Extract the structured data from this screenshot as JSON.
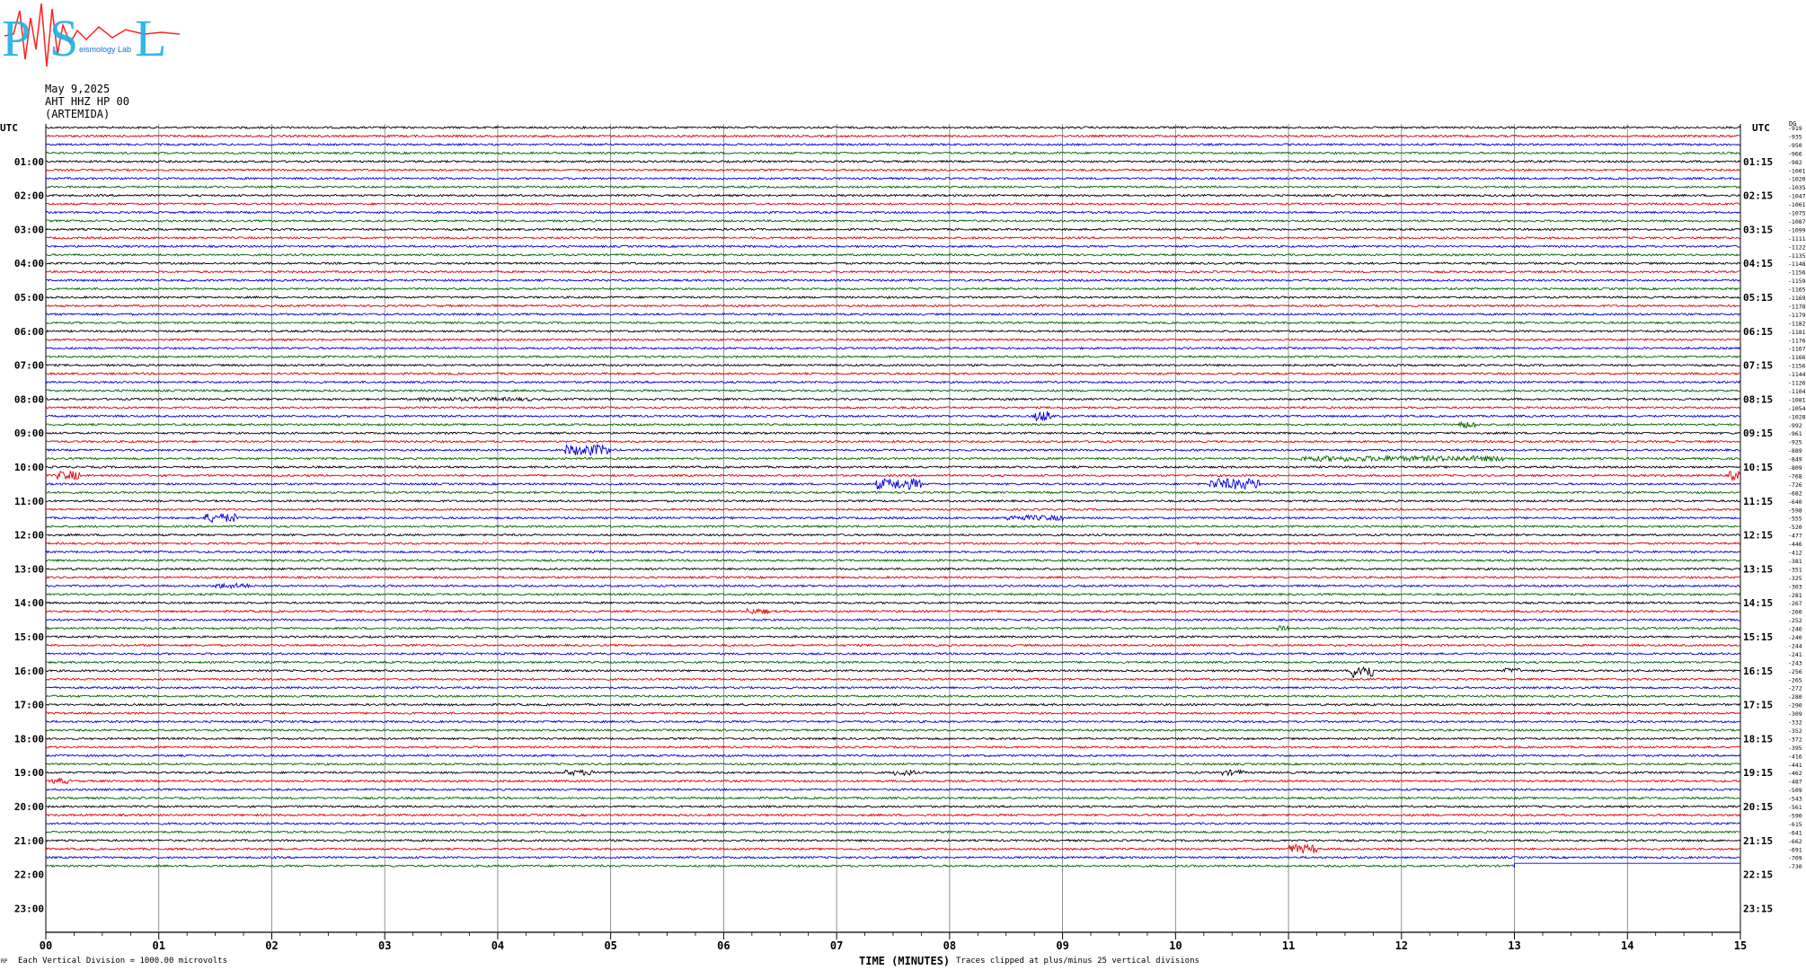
{
  "logo": {
    "letters": [
      "P",
      "S",
      "L"
    ],
    "caption": "eismology Lab",
    "colors": {
      "letters": "#1fb0e6",
      "wave": "#ff2020"
    }
  },
  "header": {
    "date": "May 9,2025",
    "station": "AHT HHZ HP 00",
    "name": "(ARTEMIDA)"
  },
  "axis": {
    "left_title": "UTC",
    "right_title": "UTC",
    "right_corner": "DG",
    "xlabel": "TIME (MINUTES)",
    "footer_left": "Each Vertical Division = 1000.00 microvolts",
    "footer_mid": "Traces clipped at plus/minus 25 vertical divisions",
    "tiny_mark": "RP"
  },
  "chart_data": {
    "type": "line",
    "title": "",
    "x_minutes": [
      "00",
      "01",
      "02",
      "03",
      "04",
      "05",
      "06",
      "07",
      "08",
      "09",
      "10",
      "11",
      "12",
      "13",
      "14",
      "15"
    ],
    "xlim": [
      0,
      15
    ],
    "left_hours": [
      "01:00",
      "02:00",
      "03:00",
      "04:00",
      "05:00",
      "06:00",
      "07:00",
      "08:00",
      "09:00",
      "10:00",
      "11:00",
      "12:00",
      "13:00",
      "14:00",
      "15:00",
      "16:00",
      "17:00",
      "18:00",
      "19:00",
      "20:00",
      "21:00",
      "22:00",
      "23:00"
    ],
    "right_hours": [
      "01:15",
      "02:15",
      "03:15",
      "04:15",
      "05:15",
      "06:15",
      "07:15",
      "08:15",
      "09:15",
      "10:15",
      "11:15",
      "12:15",
      "13:15",
      "14:15",
      "15:15",
      "16:15",
      "17:15",
      "18:15",
      "19:15",
      "20:15",
      "21:15",
      "22:15",
      "23:15"
    ],
    "trace_colors": [
      "#000000",
      "#e00000",
      "#0000e0",
      "#006400"
    ],
    "full_traces": 87,
    "last_trace_end_minute": 13.0,
    "grid": true,
    "right_offsets": [
      -919,
      -935,
      -950,
      -966,
      -982,
      -1001,
      -1020,
      -1035,
      -1047,
      -1061,
      -1075,
      -1087,
      -1099,
      -1111,
      -1122,
      -1135,
      -1148,
      -1156,
      -1159,
      -1165,
      -1169,
      -1178,
      -1179,
      -1182,
      -1181,
      -1176,
      -1167,
      -1166,
      -1156,
      -1144,
      -1126,
      -1104,
      -1081,
      -1054,
      -1028,
      -992,
      -961,
      -925,
      -889,
      -849,
      -809,
      -768,
      -726,
      -682,
      -640,
      -598,
      -555,
      -520,
      -477,
      -446,
      -412,
      -381,
      -351,
      -325,
      -303,
      -281,
      -267,
      -260,
      -252,
      -246,
      -240,
      -244,
      -241,
      -243,
      -256,
      -265,
      -272,
      -280,
      -290,
      -309,
      -332,
      -352,
      -372,
      -395,
      -416,
      -441,
      -462,
      -487,
      -509,
      -543,
      -561,
      -590,
      -615,
      -641,
      -662,
      -691,
      -709,
      -730
    ],
    "events": [
      {
        "trace": 32,
        "minute": 3.3,
        "amp": 2,
        "len": 1.0
      },
      {
        "trace": 34,
        "minute": 8.75,
        "amp": 6,
        "len": 0.15
      },
      {
        "trace": 35,
        "minute": 12.5,
        "amp": 4,
        "len": 0.15
      },
      {
        "trace": 38,
        "minute": 4.6,
        "amp": 6,
        "len": 0.4
      },
      {
        "trace": 39,
        "minute": 11.1,
        "amp": 3,
        "len": 1.8
      },
      {
        "trace": 41,
        "minute": 0.1,
        "amp": 5,
        "len": 0.2
      },
      {
        "trace": 41,
        "minute": 14.9,
        "amp": 5,
        "len": 0.15
      },
      {
        "trace": 42,
        "minute": 7.35,
        "amp": 6,
        "len": 0.4
      },
      {
        "trace": 42,
        "minute": 10.3,
        "amp": 6,
        "len": 0.45
      },
      {
        "trace": 46,
        "minute": 1.4,
        "amp": 5,
        "len": 0.3
      },
      {
        "trace": 46,
        "minute": 8.5,
        "amp": 3,
        "len": 0.5
      },
      {
        "trace": 54,
        "minute": 1.5,
        "amp": 3,
        "len": 0.3
      },
      {
        "trace": 57,
        "minute": 6.2,
        "amp": 3,
        "len": 0.2
      },
      {
        "trace": 59,
        "minute": 10.9,
        "amp": 4,
        "len": 0.1
      },
      {
        "trace": 64,
        "minute": 11.55,
        "amp": 8,
        "len": 0.2
      },
      {
        "trace": 64,
        "minute": 12.9,
        "amp": 3,
        "len": 0.15
      },
      {
        "trace": 76,
        "minute": 4.6,
        "amp": 3,
        "len": 0.3
      },
      {
        "trace": 76,
        "minute": 7.5,
        "amp": 3,
        "len": 0.2
      },
      {
        "trace": 76,
        "minute": 10.4,
        "amp": 3,
        "len": 0.2
      },
      {
        "trace": 77,
        "minute": 0.05,
        "amp": 3,
        "len": 0.15
      },
      {
        "trace": 85,
        "minute": 11.0,
        "amp": 5,
        "len": 0.25
      }
    ]
  }
}
